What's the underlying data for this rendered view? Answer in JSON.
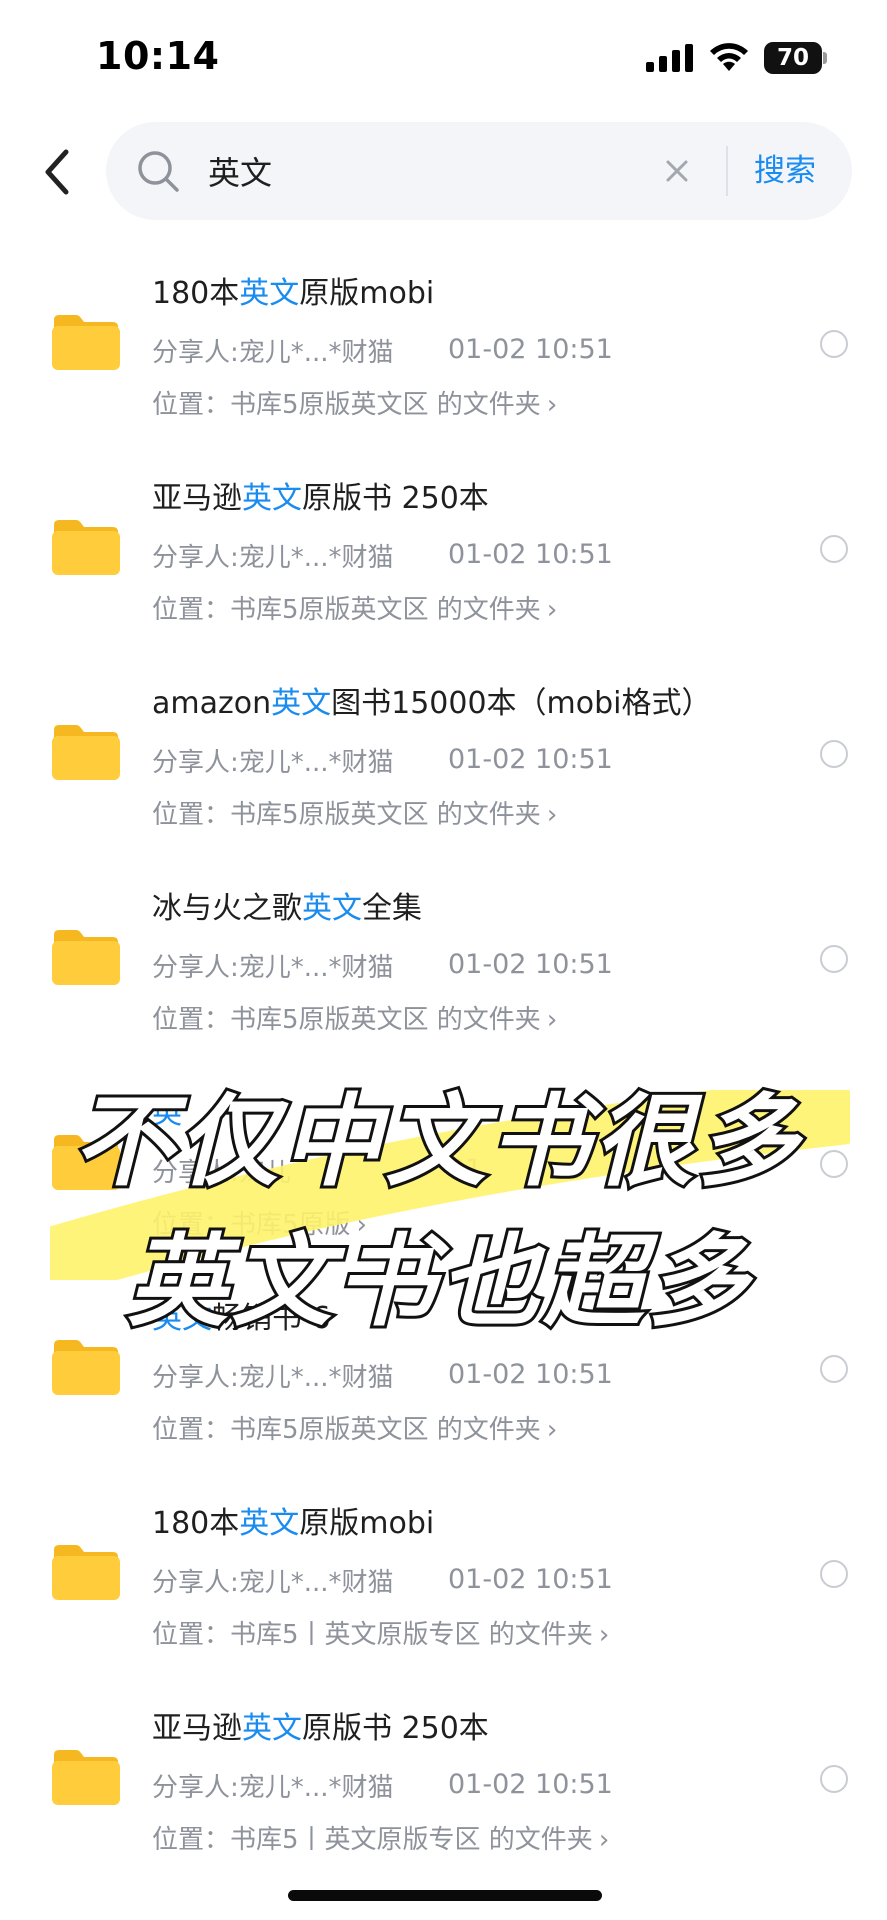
{
  "status_bar": {
    "time": "10:14",
    "battery": "70"
  },
  "search": {
    "query": "英文",
    "button_label": "搜索"
  },
  "colors": {
    "accent": "#1a8cf0",
    "folder": "#ffcc33",
    "meta_text": "#8e929b"
  },
  "results": [
    {
      "title_parts": [
        "180本",
        "英文",
        "原版mobi"
      ],
      "sharer": "分享人:宠儿*...*财猫",
      "date": "01-02 10:51",
      "location": "位置：书库5原版英文区 的文件夹",
      "chevron": "›"
    },
    {
      "title_parts": [
        "亚马逊",
        "英文",
        "原版书 250本"
      ],
      "sharer": "分享人:宠儿*...*财猫",
      "date": "01-02 10:51",
      "location": "位置：书库5原版英文区 的文件夹",
      "chevron": "›"
    },
    {
      "title_parts": [
        "amazon",
        "英文",
        "图书15000本（mobi格式）"
      ],
      "sharer": "分享人:宠儿*...*财猫",
      "date": "01-02 10:51",
      "location": "位置：书库5原版英文区 的文件夹",
      "chevron": "›"
    },
    {
      "title_parts": [
        "冰与火之歌",
        "英文",
        "全集"
      ],
      "sharer": "分享人:宠儿*...*财猫",
      "date": "01-02 10:51",
      "location": "位置：书库5原版英文区 的文件夹",
      "chevron": "›"
    },
    {
      "title_parts": [
        "",
        "英",
        ""
      ],
      "sharer": "分享人:宠儿",
      "date": "01",
      "location": "位置：书库5原版",
      "chevron": "›"
    },
    {
      "title_parts": [
        "",
        "英文",
        "畅销书 6"
      ],
      "sharer": "分享人:宠儿*...*财猫",
      "date": "01-02 10:51",
      "location": "位置：书库5原版英文区 的文件夹",
      "chevron": "›"
    },
    {
      "title_parts": [
        "180本",
        "英文",
        "原版mobi"
      ],
      "sharer": "分享人:宠儿*...*财猫",
      "date": "01-02 10:51",
      "location": "位置：书库5丨英文原版专区 的文件夹",
      "chevron": "›"
    },
    {
      "title_parts": [
        "亚马逊",
        "英文",
        "原版书 250本"
      ],
      "sharer": "分享人:宠儿*...*财猫",
      "date": "01-02 10:51",
      "location": "位置：书库5丨英文原版专区 的文件夹",
      "chevron": "›"
    }
  ],
  "overlay": {
    "line1": "不仅中文书很多",
    "line2": "英文书也超多"
  }
}
